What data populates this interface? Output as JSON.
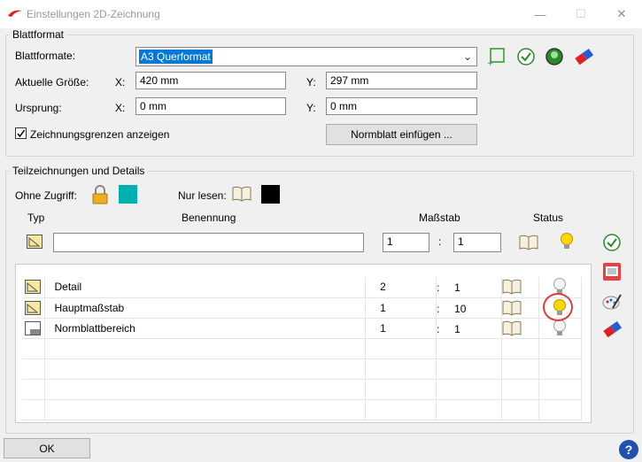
{
  "window": {
    "title": "Einstellungen 2D-Zeichnung",
    "logo_icon": "red-swoosh-logo",
    "controls": {
      "minimize": "—",
      "maximize": "☐",
      "close": "✕"
    }
  },
  "blattformat": {
    "group_label": "Blattformat",
    "format_label": "Blattformate:",
    "format_value": "A3 Querformat",
    "size_label": "Aktuelle Größe:",
    "x_label": "X:",
    "y_label": "Y:",
    "size_x": "420 mm",
    "size_y": "297 mm",
    "origin_label": "Ursprung:",
    "origin_x": "0 mm",
    "origin_y": "0 mm",
    "show_bounds_label": "Zeichnungsgrenzen anzeigen",
    "show_bounds_checked": true,
    "insert_button": "Normblatt einfügen ..."
  },
  "teilzeichnungen": {
    "group_label": "Teilzeichnungen und Details",
    "no_access_label": "Ohne Zugriff:",
    "read_only_label": "Nur lesen:",
    "no_access_color": "#00b0b0",
    "read_only_color": "#000000",
    "headers": {
      "type": "Typ",
      "name": "Benennung",
      "scale": "Maßstab",
      "status": "Status"
    },
    "new_entry": {
      "name": "",
      "scale_a": "1",
      "sep": ":",
      "scale_b": "1"
    },
    "rows": [
      {
        "name": "Detail",
        "scale_a": "2",
        "sep": ":",
        "scale_b": "1",
        "type_icon": "detail-sheet-icon",
        "status": "off"
      },
      {
        "name": "Hauptmaßstab",
        "scale_a": "1",
        "sep": ":",
        "scale_b": "10",
        "type_icon": "detail-sheet-icon",
        "status": "on"
      },
      {
        "name": "Normblattbereich",
        "scale_a": "1",
        "sep": ":",
        "scale_b": "1",
        "type_icon": "titleblock-icon",
        "status": "off"
      }
    ]
  },
  "footer": {
    "ok_label": "OK",
    "help_icon": "?"
  }
}
